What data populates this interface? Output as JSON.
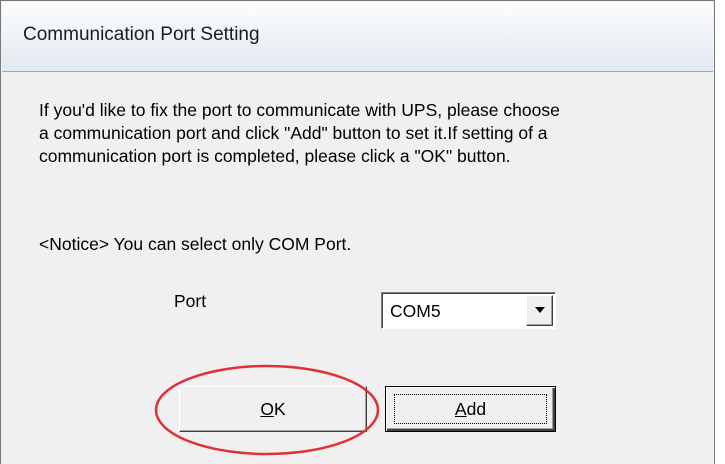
{
  "dialog": {
    "title": "Communication Port Setting",
    "message_lines": [
      "If you'd like to fix the port to communicate with UPS, please choose",
      "a communication port and click \"Add\" button to set it.If setting of a",
      "communication port is completed, please click a \"OK\" button."
    ],
    "notice": "<Notice> You can select only COM Port.",
    "port_label": "Port",
    "port_select": {
      "value": "COM5"
    },
    "ok_button": {
      "mnemonic": "O",
      "rest": "K"
    },
    "add_button": {
      "mnemonic": "A",
      "rest": "dd"
    }
  },
  "colors": {
    "dialog_background": "#f0f0f0",
    "highlight_ellipse": "#e0303a"
  }
}
